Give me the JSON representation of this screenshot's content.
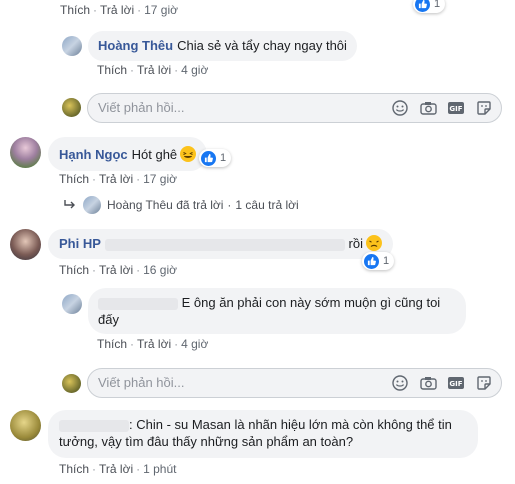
{
  "common": {
    "like": "Thích",
    "reply": "Trả lời",
    "sep": "·",
    "write_reply_placeholder": "Viết phản hồi..."
  },
  "top": {
    "time": "17 giờ"
  },
  "c1_reply": {
    "name": "Hoàng Thêu",
    "text": "Chia sẻ và tẩy chay ngay thôi",
    "time": "4 giờ"
  },
  "c2": {
    "name": "Hạnh Ngọc",
    "text": "Hót ghê",
    "reactions": "1",
    "time": "17 giờ",
    "replies_summary": {
      "name": "Hoàng Thêu",
      "action": "đã trả lời",
      "count": "1 câu trả lời"
    }
  },
  "c3": {
    "name": "Phi HP",
    "text": "rồi",
    "reactions": "1",
    "time": "16 giờ"
  },
  "c3_reply": {
    "text": "E ông ăn phải con này sớm muộn gì cũng toi đấy",
    "time": "4 giờ"
  },
  "c4": {
    "text": ": Chin - su Masan là nhãn hiệu lớn mà còn không thể tin tưởng, vậy tìm đâu thấy những sản phẩm an toàn?",
    "time": "1 phút"
  },
  "icons": [
    "like-icon",
    "emoji-icon",
    "camera-icon",
    "gif-icon",
    "sticker-icon",
    "reply-arrow-icon",
    "laugh-emoji",
    "sad-emoji"
  ],
  "colors": {
    "link": "#385898",
    "bubble": "#f2f3f5",
    "like": "#1877f2",
    "meta": "#606770"
  }
}
